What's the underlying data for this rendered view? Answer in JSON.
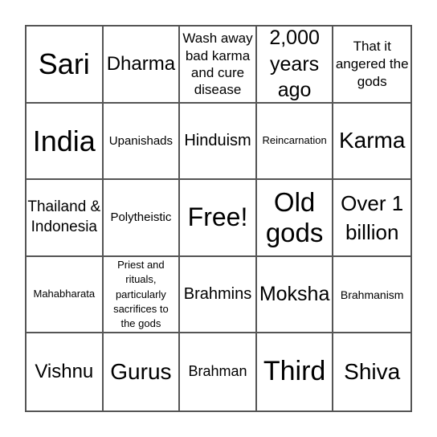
{
  "board": {
    "rows": [
      [
        "Sari",
        "Dharma",
        "Wash away bad karma and cure disease",
        "2,000 years ago",
        "That it angered the gods"
      ],
      [
        "India",
        "Upanishads",
        "Hinduism",
        "Reincarnation",
        "Karma"
      ],
      [
        "Thailand & Indonesia",
        "Polytheistic",
        "Free!",
        "Old gods",
        "Over 1 billion"
      ],
      [
        "Mahabharata",
        "Priest and rituals, particularly sacrifices to the gods",
        "Brahmins",
        "Moksha",
        "Brahmanism"
      ],
      [
        "Vishnu",
        "Gurus",
        "Brahman",
        "Third",
        "Shiva"
      ]
    ],
    "free_space": "Free!",
    "line_color": "#555555"
  }
}
